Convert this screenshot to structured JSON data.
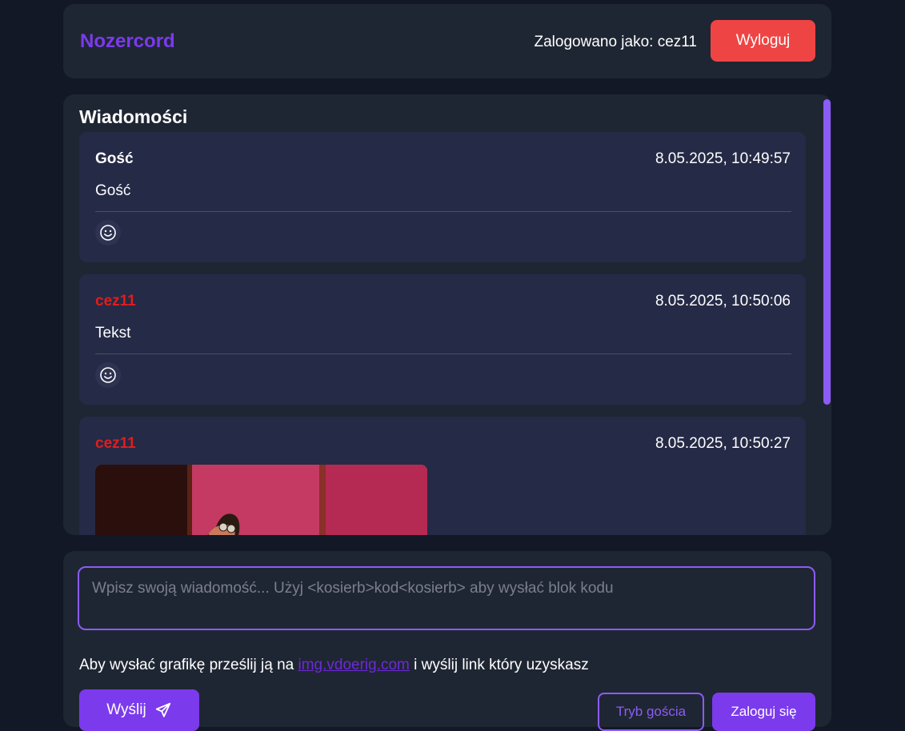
{
  "header": {
    "brand": "Nozercord",
    "logged_in_text": "Zalogowano jako: cez11",
    "logout_label": "Wyloguj"
  },
  "messages_panel": {
    "title": "Wiadomości",
    "messages": [
      {
        "author": "Gość",
        "author_color": "#ffffff",
        "time": "8.05.2025, 10:49:57",
        "text": "Gość",
        "reaction_icon": "smiley-icon"
      },
      {
        "author": "cez11",
        "author_color": "#e11d1d",
        "time": "8.05.2025, 10:50:06",
        "text": "Tekst",
        "reaction_icon": "smiley-icon"
      },
      {
        "author": "cez11",
        "author_color": "#e11d1d",
        "time": "8.05.2025, 10:50:27",
        "content": "image"
      }
    ]
  },
  "compose": {
    "placeholder": "Wpisz swoją wiadomość... Użyj <kosierb>kod<kosierb> aby wysłać blok kodu",
    "upload_prefix": "Aby wysłać grafikę prześlij ją na",
    "upload_link": "img.vdoerig.com",
    "upload_suffix": "i wyślij link który uzyskasz",
    "send_label": "Wyślij",
    "send_icon": "paper-plane-icon",
    "guest_label": "Tryb gościa",
    "login_label": "Zaloguj się"
  },
  "colors": {
    "accent": "#7c3aed",
    "danger": "#ef4444",
    "background": "#121826",
    "panel": "#1f2633",
    "message_card": "#252a46"
  }
}
